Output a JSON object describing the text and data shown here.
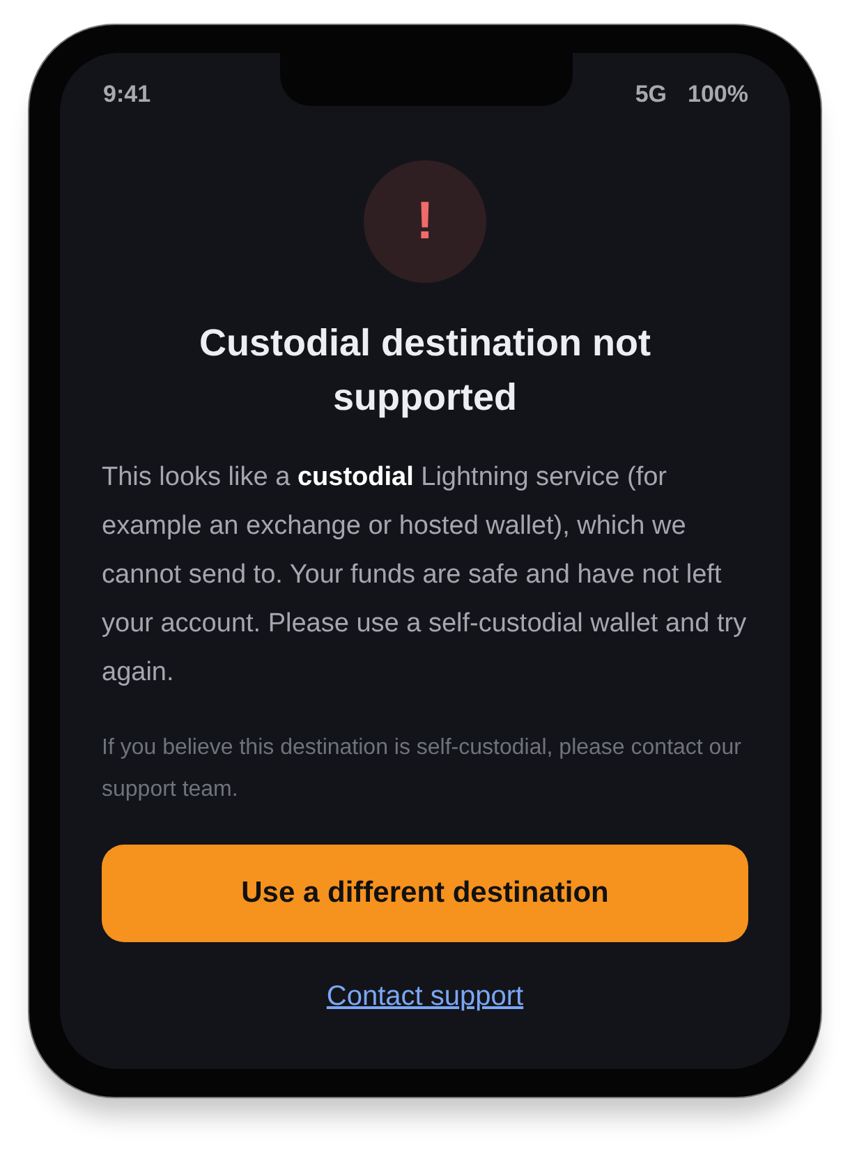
{
  "status_bar": {
    "time": "9:41",
    "network": "5G",
    "battery": "100%"
  },
  "alert": {
    "icon": "!",
    "title": "Custodial destination not supported",
    "message": "This looks like a **custodial** Lightning service (for example an exchange or hosted wallet), which we cannot send to. Your funds are safe and have not left your account. Please use a self-custodial wallet and try again.",
    "note": "If you believe this destination is self-custodial, please contact our support team."
  },
  "primary_button": {
    "label": "Use a different destination"
  },
  "link": {
    "label": "Contact support"
  }
}
